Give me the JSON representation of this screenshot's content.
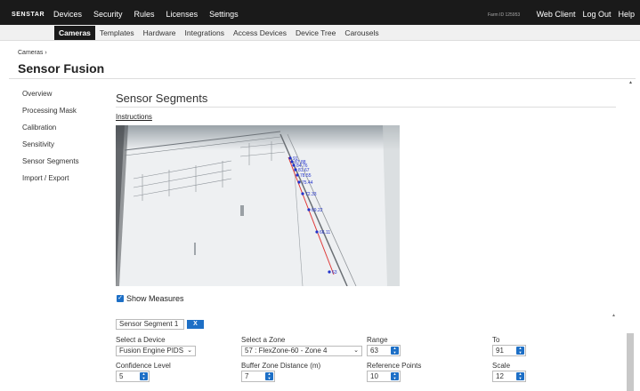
{
  "topbar": {
    "logo": "SENSTAR",
    "nav": [
      "Devices",
      "Security",
      "Rules",
      "Licenses",
      "Settings"
    ],
    "farm_id": "Farm ID 125953",
    "right": [
      "Web Client",
      "Log Out",
      "Help"
    ]
  },
  "subnav": {
    "items": [
      "Cameras",
      "Templates",
      "Hardware",
      "Integrations",
      "Access Devices",
      "Device Tree",
      "Carousels"
    ],
    "active": "Cameras"
  },
  "breadcrumb": "Cameras ›",
  "page_title": "Sensor Fusion",
  "sidebar": [
    "Overview",
    "Processing Mask",
    "Calibration",
    "Sensitivity",
    "Sensor Segments",
    "Import / Export"
  ],
  "section_title": "Sensor Segments",
  "instructions": "Instructions",
  "camera": {
    "measure_labels": [
      "91",
      "87.88",
      "84.76",
      "81.67",
      "78.55",
      "75.44",
      "72.33",
      "69.22",
      "66.11",
      "63"
    ]
  },
  "show_measures": "Show Measures",
  "segment": {
    "name": "Sensor Segment 1",
    "remove_label": "X"
  },
  "form": {
    "device_label": "Select a Device",
    "device_value": "Fusion Engine PIDS",
    "zone_label": "Select a Zone",
    "zone_value": "57 : FlexZone-60 - Zone 4",
    "range_label": "Range",
    "range_value": "63",
    "to_label": "To",
    "to_value": "91",
    "confidence_label": "Confidence Level",
    "confidence_value": "5",
    "buffer_label": "Buffer Zone Distance (m)",
    "buffer_value": "7",
    "refpoints_label": "Reference Points",
    "refpoints_value": "10",
    "scale_label": "Scale",
    "scale_value": "12"
  }
}
